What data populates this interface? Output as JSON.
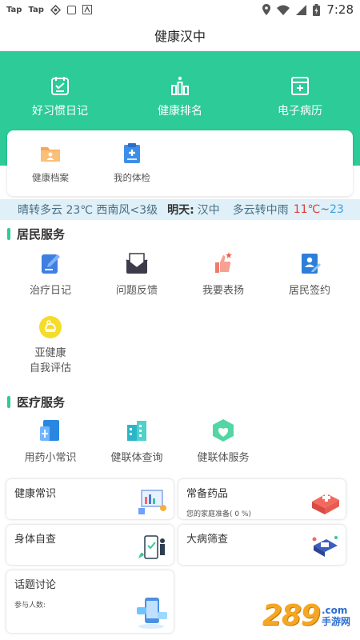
{
  "status_bar": {
    "left_apps": [
      "Tap",
      "Tap"
    ],
    "time": "7:28"
  },
  "title": "健康汉中",
  "main_nav": [
    {
      "label": "好习惯日记",
      "icon": "diary-icon"
    },
    {
      "label": "健康排名",
      "icon": "ranking-icon"
    },
    {
      "label": "电子病历",
      "icon": "medical-record-icon"
    }
  ],
  "quick": [
    {
      "label": "健康档案",
      "icon": "health-file-icon"
    },
    {
      "label": "我的体检",
      "icon": "checkup-icon"
    }
  ],
  "weather": {
    "today": "晴转多云 23℃ 西南风<3级",
    "tomorrow_label": "明天:",
    "city": "汉中",
    "tomorrow_text": "多云转中雨",
    "high": "11℃",
    "sep": "~",
    "low": "23"
  },
  "resident": {
    "title": "居民服务",
    "items": [
      {
        "label": "治疗日记",
        "icon": "treatment-diary-icon"
      },
      {
        "label": "问题反馈",
        "icon": "feedback-icon"
      },
      {
        "label": "我要表扬",
        "icon": "praise-icon"
      },
      {
        "label": "居民签约",
        "icon": "sign-contract-icon"
      },
      {
        "label": "亚健康",
        "label2": "自我评估",
        "icon": "subhealth-icon"
      }
    ]
  },
  "medical": {
    "title": "医疗服务",
    "items": [
      {
        "label": "用药小常识",
        "icon": "medication-icon"
      },
      {
        "label": "健联体查询",
        "icon": "hospital-query-icon"
      },
      {
        "label": "健联体服务",
        "icon": "hospital-service-icon"
      }
    ]
  },
  "tiles": {
    "knowledge": {
      "title": "健康常识"
    },
    "medicine": {
      "title": "常备药品",
      "sub": "您的家庭准备( 0 %)"
    },
    "selfcheck": {
      "title": "身体自查"
    },
    "screening": {
      "title": "大病筛查"
    },
    "topics": {
      "title": "话题讨论",
      "sub": "参与人数:"
    }
  },
  "watermark": {
    "big": "289",
    "small": ".com",
    "cn": "手游网"
  },
  "colors": {
    "brand": "#2ccb98",
    "weather_bg": "#dff0f8",
    "hot": "#e53935",
    "cold": "#3aa0d8"
  }
}
